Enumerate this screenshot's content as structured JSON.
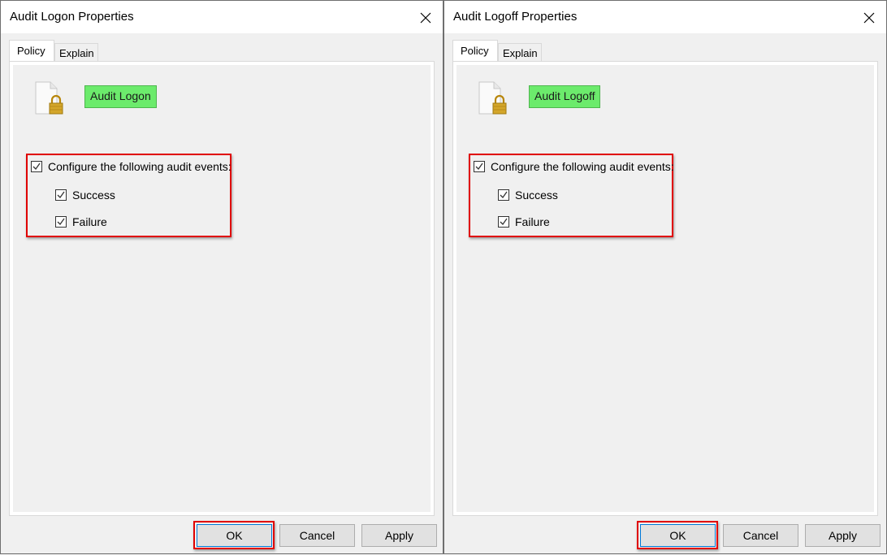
{
  "dialogs": [
    {
      "title": "Audit Logon Properties",
      "tabs": [
        {
          "label": "Policy",
          "active": true
        },
        {
          "label": "Explain",
          "active": false
        }
      ],
      "policy_icon": "document-lock-icon",
      "policy_name": "Audit Logon",
      "policy_name_bg": "#6ceb6c",
      "configure": {
        "label": "Configure the following audit events:",
        "checked": true
      },
      "success": {
        "label": "Success",
        "checked": true
      },
      "failure": {
        "label": "Failure",
        "checked": true
      },
      "buttons": {
        "ok": "OK",
        "cancel": "Cancel",
        "apply": "Apply"
      },
      "highlight_color": "#e00000"
    },
    {
      "title": "Audit Logoff Properties",
      "tabs": [
        {
          "label": "Policy",
          "active": true
        },
        {
          "label": "Explain",
          "active": false
        }
      ],
      "policy_icon": "document-lock-icon",
      "policy_name": "Audit Logoff",
      "policy_name_bg": "#6ceb6c",
      "configure": {
        "label": "Configure the following audit events:",
        "checked": true
      },
      "success": {
        "label": "Success",
        "checked": true
      },
      "failure": {
        "label": "Failure",
        "checked": true
      },
      "buttons": {
        "ok": "OK",
        "cancel": "Cancel",
        "apply": "Apply"
      },
      "highlight_color": "#e00000"
    }
  ]
}
